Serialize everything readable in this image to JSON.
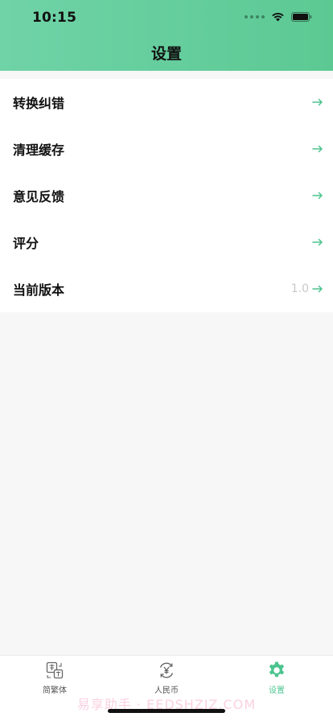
{
  "status_bar": {
    "time": "10:15",
    "icons": [
      "signal-dots-icon",
      "wifi-icon",
      "battery-icon"
    ]
  },
  "nav": {
    "title": "设置"
  },
  "settings": {
    "items": [
      {
        "label": "转换纠错",
        "value": "",
        "icon": "arrow-right-icon"
      },
      {
        "label": "清理缓存",
        "value": "",
        "icon": "arrow-right-icon"
      },
      {
        "label": "意见反馈",
        "value": "",
        "icon": "arrow-right-icon"
      },
      {
        "label": "评分",
        "value": "",
        "icon": "arrow-right-icon"
      },
      {
        "label": "当前版本",
        "value": "1.0",
        "icon": "arrow-right-icon"
      }
    ]
  },
  "tabbar": {
    "tabs": [
      {
        "label": "简繁体",
        "icon": "convert-chinese-icon",
        "active": false
      },
      {
        "label": "人民币",
        "icon": "rmb-currency-icon",
        "active": false
      },
      {
        "label": "设置",
        "icon": "gear-icon",
        "active": true
      }
    ]
  },
  "watermark": {
    "text": "易享助手 · EEDSHZJZ.COM"
  },
  "colors": {
    "accent": "#4cc48f",
    "header_start": "#6fd3a7",
    "header_end": "#5cc993",
    "page_bg": "#f7f7f7"
  }
}
